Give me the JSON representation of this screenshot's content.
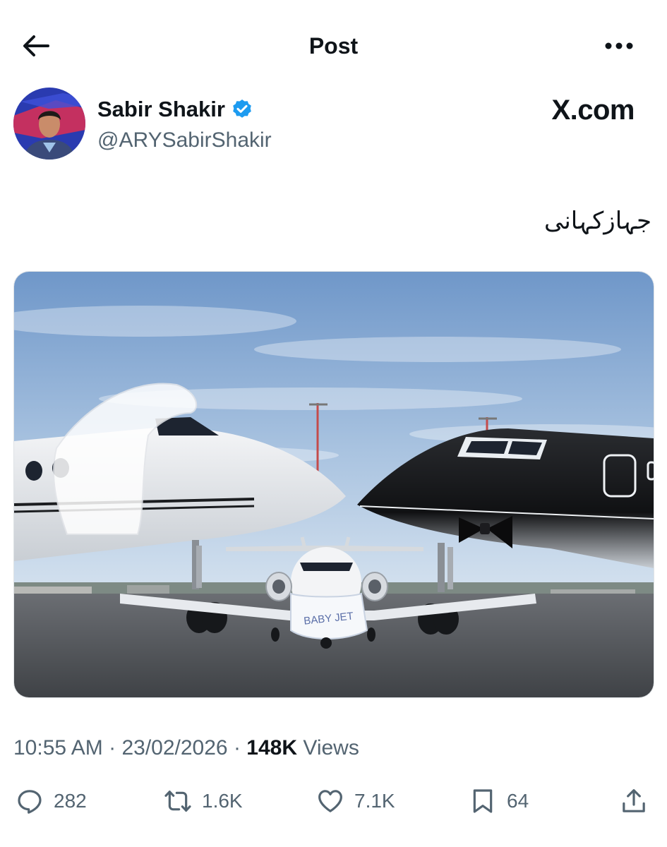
{
  "header": {
    "title": "Post",
    "back_icon": "arrow-left-icon",
    "more_icon": "more-horizontal-icon"
  },
  "author": {
    "name": "Sabir Shakir",
    "handle": "@ARYSabirShakir",
    "verified": true,
    "verified_color": "#1d9bf0"
  },
  "watermark": {
    "text": "X.com"
  },
  "post": {
    "text": "جہازکہانی"
  },
  "media": {
    "signage_text": "BABY JET",
    "description_icon": "photo"
  },
  "meta": {
    "time": "10:55 AM",
    "separator": "·",
    "date": "23/02/2026",
    "views_count": "148K",
    "views_label": "Views"
  },
  "actions": {
    "replies": "282",
    "reposts": "1.6K",
    "likes": "7.1K",
    "bookmarks": "64"
  },
  "colors": {
    "text": "#0f1419",
    "secondary": "#536471",
    "accent": "#1d9bf0"
  }
}
